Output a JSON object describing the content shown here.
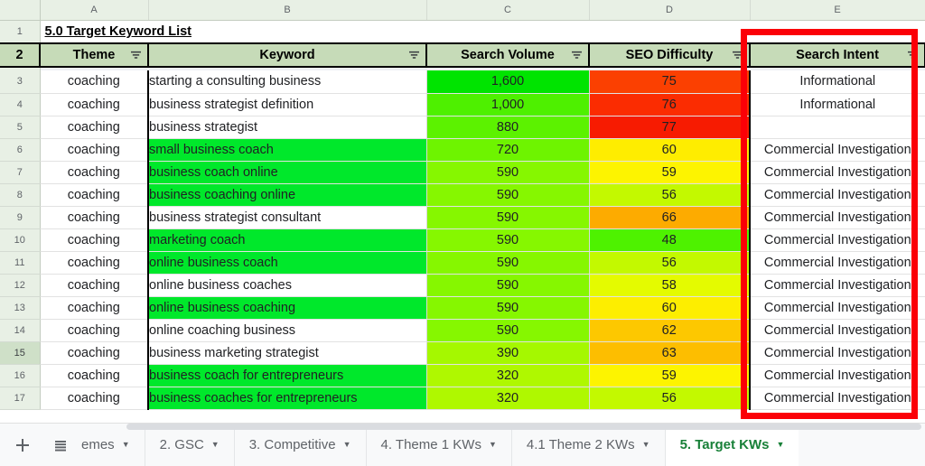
{
  "sheet": {
    "title": "5.0 Target Keyword List",
    "column_letters": [
      "A",
      "B",
      "C",
      "D",
      "E"
    ],
    "headers": {
      "a": "Theme",
      "b": "Keyword",
      "c": "Search Volume",
      "d": "SEO Difficulty",
      "e": "Search Intent"
    },
    "filter_icon": "filter-icon",
    "selected_row": 15,
    "rows": [
      {
        "n": 3,
        "theme": "coaching",
        "keyword": "starting a consulting business",
        "kw_fill": "#ffffff",
        "volume": "1,600",
        "vol_fill": "#00e400",
        "difficulty": "75",
        "diff_fill": "#fb4001",
        "intent": "Informational"
      },
      {
        "n": 4,
        "theme": "coaching",
        "keyword": "business strategist definition",
        "kw_fill": "#ffffff",
        "volume": "1,000",
        "vol_fill": "#4ef000",
        "difficulty": "76",
        "diff_fill": "#fb2c01",
        "intent": "Informational"
      },
      {
        "n": 5,
        "theme": "coaching",
        "keyword": "business strategist",
        "kw_fill": "#ffffff",
        "volume": "880",
        "vol_fill": "#5cf200",
        "difficulty": "77",
        "diff_fill": "#f71b01",
        "intent": ""
      },
      {
        "n": 6,
        "theme": "coaching",
        "keyword": "small business coach",
        "kw_fill": "#00e82b",
        "volume": "720",
        "vol_fill": "#6ef400",
        "difficulty": "60",
        "diff_fill": "#feed00",
        "intent": "Commercial Investigation"
      },
      {
        "n": 7,
        "theme": "coaching",
        "keyword": "business coach online",
        "kw_fill": "#00e82b",
        "volume": "590",
        "vol_fill": "#86f700",
        "difficulty": "59",
        "diff_fill": "#fdf400",
        "intent": "Commercial Investigation"
      },
      {
        "n": 8,
        "theme": "coaching",
        "keyword": "business coaching online",
        "kw_fill": "#00e82b",
        "volume": "590",
        "vol_fill": "#86f700",
        "difficulty": "56",
        "diff_fill": "#c3f900",
        "intent": "Commercial Investigation"
      },
      {
        "n": 9,
        "theme": "coaching",
        "keyword": "business strategist consultant",
        "kw_fill": "#ffffff",
        "volume": "590",
        "vol_fill": "#86f700",
        "difficulty": "66",
        "diff_fill": "#fdab00",
        "intent": "Commercial Investigation"
      },
      {
        "n": 10,
        "theme": "coaching",
        "keyword": "marketing coach",
        "kw_fill": "#00e82b",
        "volume": "590",
        "vol_fill": "#86f700",
        "difficulty": "48",
        "diff_fill": "#4ef200",
        "intent": "Commercial Investigation"
      },
      {
        "n": 11,
        "theme": "coaching",
        "keyword": "online business coach",
        "kw_fill": "#00e82b",
        "volume": "590",
        "vol_fill": "#86f700",
        "difficulty": "56",
        "diff_fill": "#c3f900",
        "intent": "Commercial Investigation"
      },
      {
        "n": 12,
        "theme": "coaching",
        "keyword": "online business coaches",
        "kw_fill": "#ffffff",
        "volume": "590",
        "vol_fill": "#86f700",
        "difficulty": "58",
        "diff_fill": "#e4fb00",
        "intent": "Commercial Investigation"
      },
      {
        "n": 13,
        "theme": "coaching",
        "keyword": "online business coaching",
        "kw_fill": "#00e82b",
        "volume": "590",
        "vol_fill": "#86f700",
        "difficulty": "60",
        "diff_fill": "#fdee00",
        "intent": "Commercial Investigation"
      },
      {
        "n": 14,
        "theme": "coaching",
        "keyword": "online coaching business",
        "kw_fill": "#ffffff",
        "volume": "590",
        "vol_fill": "#86f700",
        "difficulty": "62",
        "diff_fill": "#fdc800",
        "intent": "Commercial Investigation"
      },
      {
        "n": 15,
        "theme": "coaching",
        "keyword": "business marketing strategist",
        "kw_fill": "#ffffff",
        "volume": "390",
        "vol_fill": "#a5f800",
        "difficulty": "63",
        "diff_fill": "#fdbe00",
        "intent": "Commercial Investigation"
      },
      {
        "n": 16,
        "theme": "coaching",
        "keyword": "business coach for entrepreneurs",
        "kw_fill": "#00e82b",
        "volume": "320",
        "vol_fill": "#aff800",
        "difficulty": "59",
        "diff_fill": "#fdf400",
        "intent": "Commercial Investigation"
      },
      {
        "n": 17,
        "theme": "coaching",
        "keyword": "business coaches for entrepreneurs",
        "kw_fill": "#00e82b",
        "volume": "320",
        "vol_fill": "#aff800",
        "difficulty": "56",
        "diff_fill": "#c3f900",
        "intent": "Commercial Investigation"
      }
    ]
  },
  "annotation": {
    "highlight_color": "#fb0007",
    "target_column": "E"
  },
  "bottom_bar": {
    "add_sheet_label": "+",
    "all_sheets_label": "all-sheets",
    "tabs": [
      {
        "label": "emes",
        "active": false,
        "clipped": true
      },
      {
        "label": "2. GSC",
        "active": false,
        "clipped": false
      },
      {
        "label": "3. Competitive",
        "active": false,
        "clipped": false
      },
      {
        "label": "4. Theme 1 KWs",
        "active": false,
        "clipped": false
      },
      {
        "label": "4.1 Theme 2 KWs",
        "active": false,
        "clipped": false
      },
      {
        "label": "5. Target KWs",
        "active": true,
        "clipped": false
      }
    ],
    "caret": "▼"
  }
}
